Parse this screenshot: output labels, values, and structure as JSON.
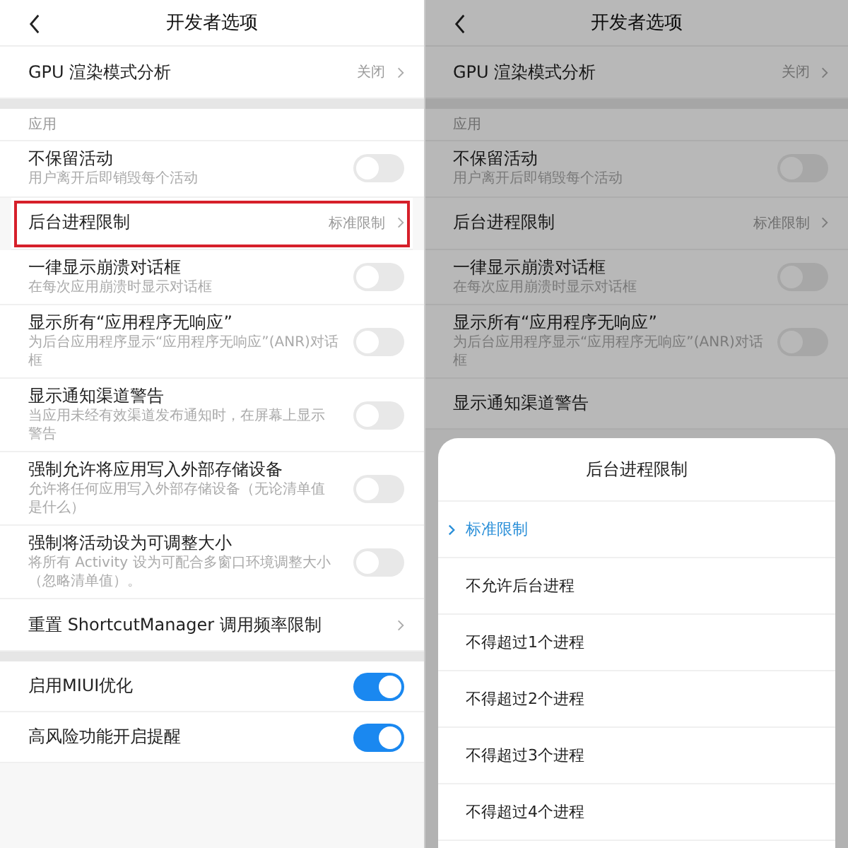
{
  "screens": [
    {
      "title": "开发者选项",
      "items": [
        {
          "kind": "nav",
          "title": "GPU 渲染模式分析",
          "value": "关闭",
          "highlighted": false
        },
        {
          "kind": "gap"
        },
        {
          "kind": "header",
          "title": "应用"
        },
        {
          "kind": "toggle",
          "title": "不保留活动",
          "subtitle": "用户离开后即销毁每个活动",
          "on": false
        },
        {
          "kind": "nav",
          "title": "后台进程限制",
          "value": "标准限制",
          "highlighted": true
        },
        {
          "kind": "toggle",
          "title": "一律显示崩溃对话框",
          "subtitle": "在每次应用崩溃时显示对话框",
          "on": false
        },
        {
          "kind": "toggle",
          "title": "显示所有“应用程序无响应”",
          "subtitle": "为后台应用程序显示“应用程序无响应”(ANR)对话框",
          "on": false
        },
        {
          "kind": "toggle",
          "title": "显示通知渠道警告",
          "subtitle": "当应用未经有效渠道发布通知时，在屏幕上显示警告",
          "on": false
        },
        {
          "kind": "toggle",
          "title": "强制允许将应用写入外部存储设备",
          "subtitle": "允许将任何应用写入外部存储设备（无论清单值是什么）",
          "on": false
        },
        {
          "kind": "toggle",
          "title": "强制将活动设为可调整大小",
          "subtitle": "将所有 Activity 设为可配合多窗口环境调整大小（忽略清单值）。",
          "on": false
        },
        {
          "kind": "nav",
          "title": "重置 ShortcutManager 调用频率限制",
          "highlighted": false
        },
        {
          "kind": "gap"
        },
        {
          "kind": "toggle",
          "title": "启用MIUI优化",
          "on": true
        },
        {
          "kind": "toggle",
          "title": "高风险功能开启提醒",
          "on": true
        }
      ]
    },
    {
      "title": "开发者选项",
      "items": [
        {
          "kind": "nav",
          "title": "GPU 渲染模式分析",
          "value": "关闭",
          "highlighted": false
        },
        {
          "kind": "gap"
        },
        {
          "kind": "header",
          "title": "应用"
        },
        {
          "kind": "toggle",
          "title": "不保留活动",
          "subtitle": "用户离开后即销毁每个活动",
          "on": false
        },
        {
          "kind": "nav",
          "title": "后台进程限制",
          "value": "标准限制",
          "highlighted": false
        },
        {
          "kind": "toggle",
          "title": "一律显示崩溃对话框",
          "subtitle": "在每次应用崩溃时显示对话框",
          "on": false
        },
        {
          "kind": "toggle",
          "title": "显示所有“应用程序无响应”",
          "subtitle": "为后台应用程序显示“应用程序无响应”(ANR)对话框",
          "on": false
        },
        {
          "kind": "toggle",
          "title": "显示通知渠道警告"
        }
      ],
      "sheet": {
        "title": "后台进程限制",
        "options": [
          {
            "label": "标准限制",
            "selected": true
          },
          {
            "label": "不允许后台进程",
            "selected": false
          },
          {
            "label": "不得超过1个进程",
            "selected": false
          },
          {
            "label": "不得超过2个进程",
            "selected": false
          },
          {
            "label": "不得超过3个进程",
            "selected": false
          },
          {
            "label": "不得超过4个进程",
            "selected": false
          }
        ]
      }
    }
  ]
}
